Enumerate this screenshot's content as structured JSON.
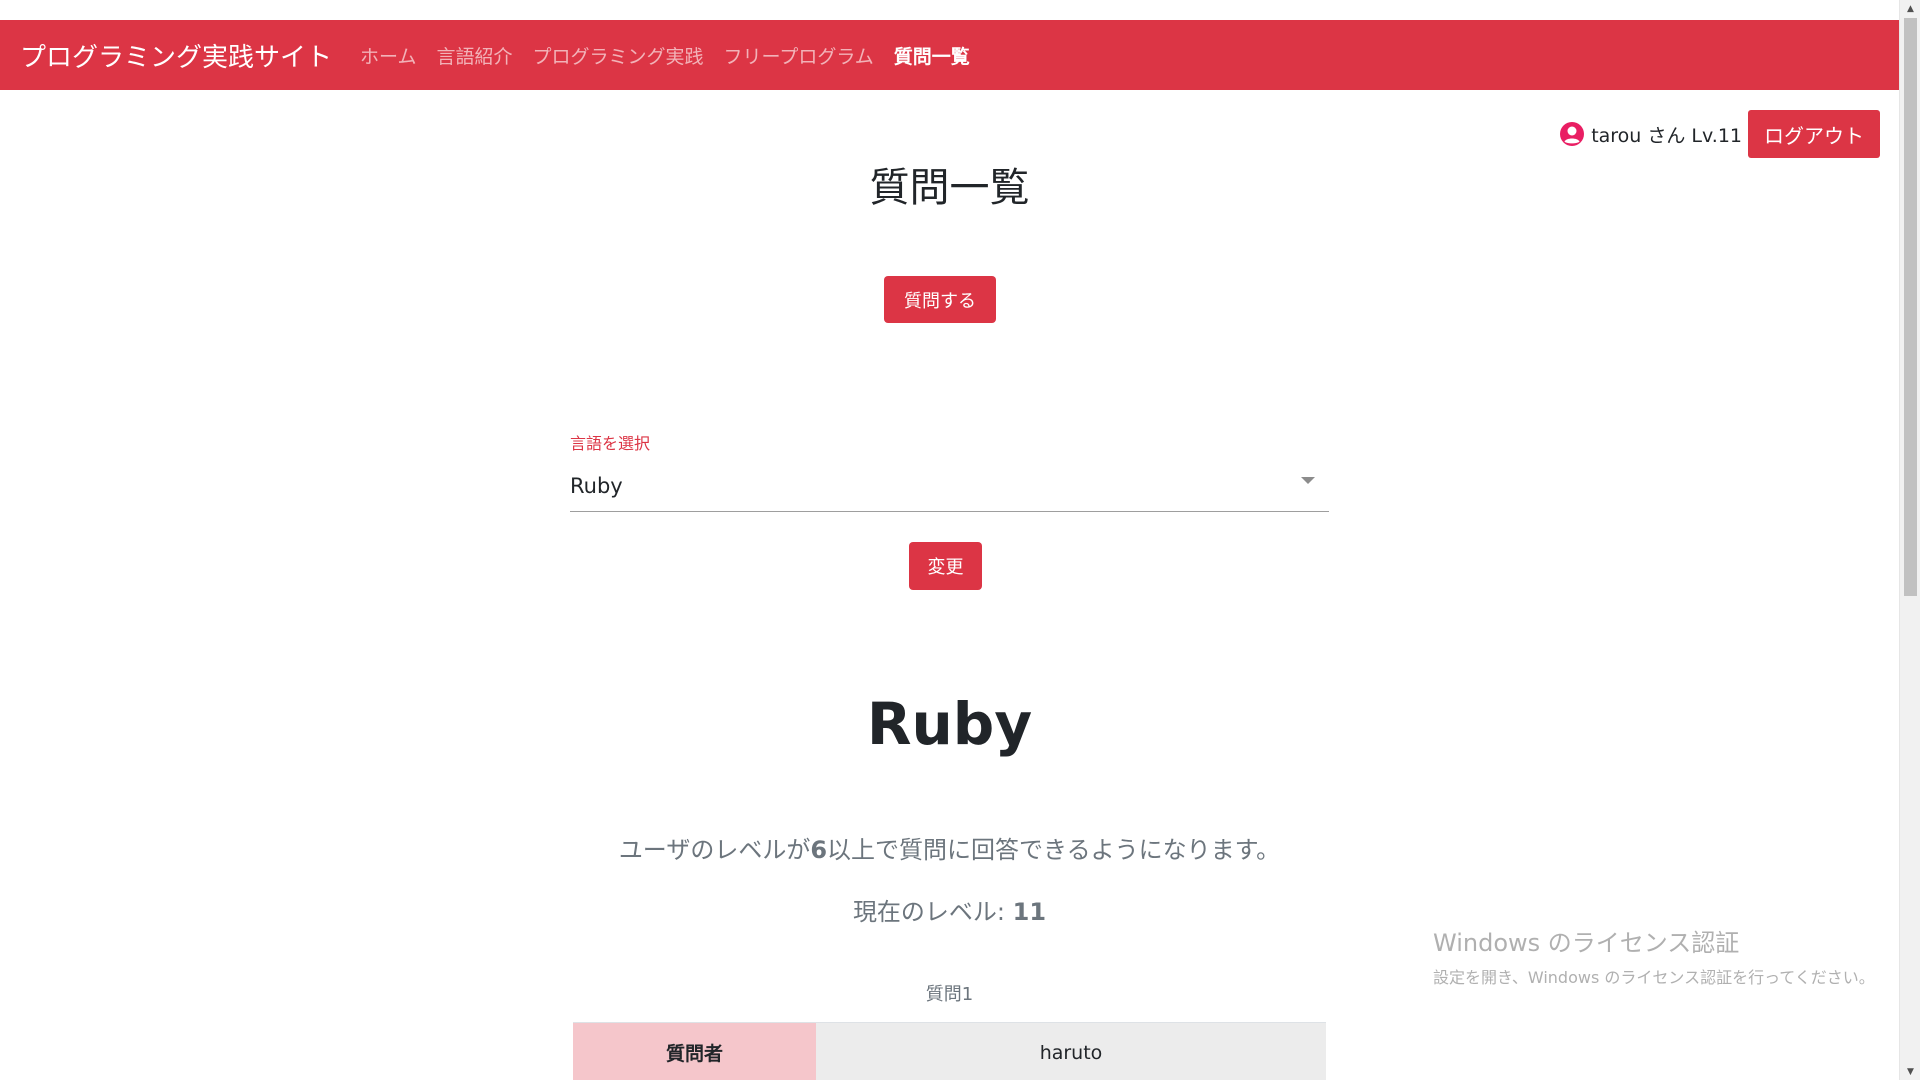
{
  "navbar": {
    "brand": "プログラミング実践サイト",
    "links": [
      {
        "label": "ホーム",
        "active": false
      },
      {
        "label": "言語紹介",
        "active": false
      },
      {
        "label": "プログラミング実践",
        "active": false
      },
      {
        "label": "フリープログラム",
        "active": false
      },
      {
        "label": "質問一覧",
        "active": true
      }
    ]
  },
  "user": {
    "icon": "user-circle-icon",
    "greeting": "tarou さん Lv.11",
    "logout_label": "ログアウト"
  },
  "page": {
    "title": "質問一覧",
    "ask_button": "質問する"
  },
  "language_select": {
    "label": "言語を選択",
    "selected": "Ruby",
    "change_button": "変更"
  },
  "language_section": {
    "heading": "Ruby",
    "info_prefix": "ユーザのレベルが",
    "info_level": "6",
    "info_suffix": "以上で質問に回答できるようになります。",
    "current_level_label": "現在のレベル: ",
    "current_level_value": "11"
  },
  "questions": [
    {
      "caption": "質問1",
      "rows": [
        {
          "header": "質問者",
          "value": "haruto"
        }
      ]
    }
  ],
  "watermark": {
    "title": "Windows のライセンス認証",
    "subtitle": "設定を開き、Windows のライセンス認証を行ってください。"
  },
  "colors": {
    "primary": "#dc3545",
    "table_header_bg": "#f5c6cb",
    "table_value_bg": "#ececec"
  }
}
